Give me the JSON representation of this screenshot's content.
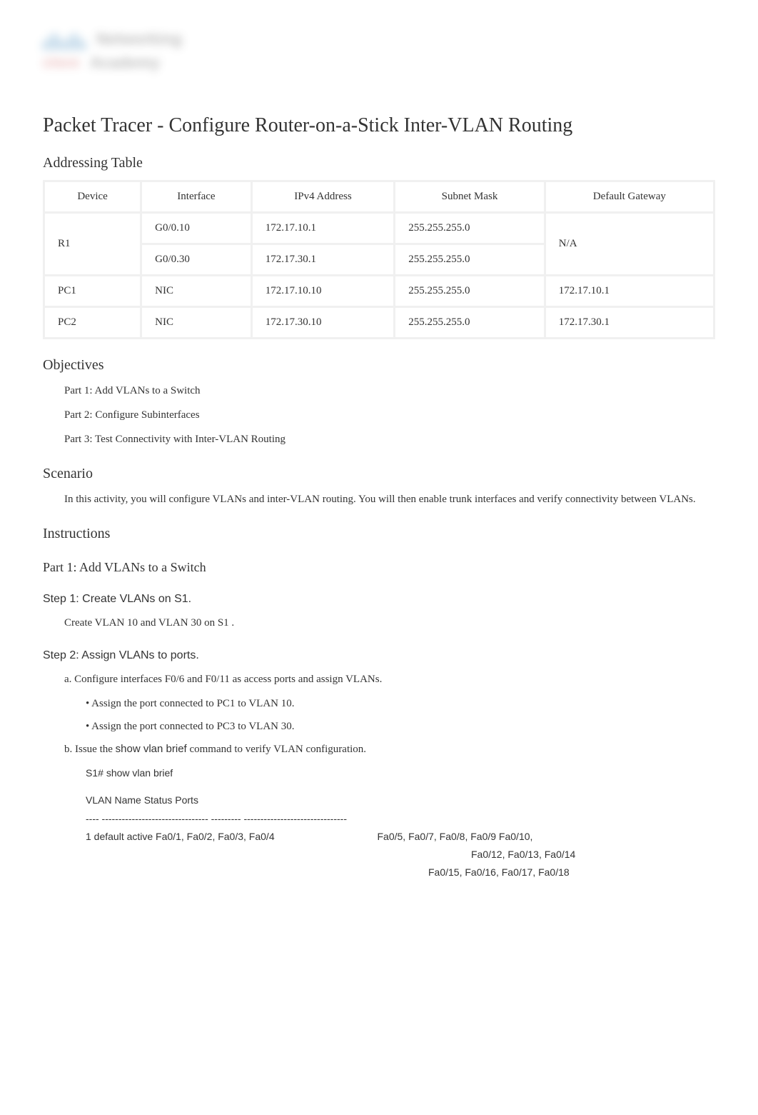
{
  "logo": {
    "word_top": "Networking",
    "word_brand": "cisco",
    "word_bottom": "Academy"
  },
  "title": "Packet Tracer - Configure Router-on-a-Stick Inter-VLAN Routing",
  "addressing_table": {
    "heading": "Addressing Table",
    "headers": [
      "Device",
      "Interface",
      "IPv4 Address",
      "Subnet Mask",
      "Default Gateway"
    ],
    "rows": [
      {
        "device": "R1",
        "interface": "G0/0.10",
        "ipv4": "172.17.10.1",
        "mask": "255.255.255.0",
        "gateway": "N/A"
      },
      {
        "device": "",
        "interface": "G0/0.30",
        "ipv4": "172.17.30.1",
        "mask": "255.255.255.0",
        "gateway": ""
      },
      {
        "device": "PC1",
        "interface": "NIC",
        "ipv4": "172.17.10.10",
        "mask": "255.255.255.0",
        "gateway": "172.17.10.1"
      },
      {
        "device": "PC2",
        "interface": "NIC",
        "ipv4": "172.17.30.10",
        "mask": "255.255.255.0",
        "gateway": "172.17.30.1"
      }
    ]
  },
  "objectives": {
    "heading": "Objectives",
    "items": [
      "Part 1: Add VLANs to a Switch",
      "Part 2: Configure Subinterfaces",
      "Part 3: Test Connectivity with Inter-VLAN Routing"
    ]
  },
  "scenario": {
    "heading": "Scenario",
    "text": " In this activity, you will configure VLANs and inter-VLAN routing. You will then enable trunk interfaces and verify connectivity between VLANs."
  },
  "instructions": {
    "heading": "Instructions"
  },
  "part1": {
    "heading": "Part 1: Add VLANs to a Switch",
    "step1": {
      "heading": "Step 1: Create VLANs on S1.",
      "text_before": "Create VLAN 10 and VLAN 30 on ",
      "device": "S1",
      "text_after": " ."
    },
    "step2": {
      "heading": "Step 2: Assign VLANs to ports.",
      "item_a": "a. Configure interfaces F0/6 and F0/11 as access ports and assign VLANs.",
      "bullet1_before": "• Assign the port connected to ",
      "bullet1_device": "PC1",
      "bullet1_after": " to VLAN 10.",
      "bullet2_before": "• Assign the port connected to ",
      "bullet2_device": "PC3",
      "bullet2_after": " to VLAN 30.",
      "item_b_before": "b. Issue the ",
      "item_b_cmd": "show vlan brief",
      "item_b_after": " command to verify VLAN configuration.",
      "cmd_prompt": "S1# ",
      "cmd_text": "show vlan brief",
      "output_header": "VLAN Name Status Ports",
      "output_divider": "---- -------------------------------- --------- -------------------------------",
      "output_line1": "1 default active Fa0/1, Fa0/2, Fa0/3, Fa0/4",
      "output_line1b": "Fa0/5, Fa0/7, Fa0/8, Fa0/9 Fa0/10,",
      "output_line2": "Fa0/12, Fa0/13, Fa0/14",
      "output_line3": "Fa0/15, Fa0/16, Fa0/17, Fa0/18"
    }
  }
}
